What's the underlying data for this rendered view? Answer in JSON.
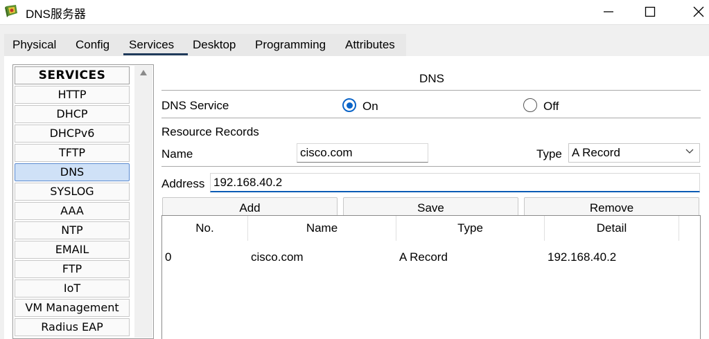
{
  "window": {
    "title": "DNS服务器"
  },
  "tabs": [
    {
      "label": "Physical"
    },
    {
      "label": "Config"
    },
    {
      "label": "Services",
      "active": true
    },
    {
      "label": "Desktop"
    },
    {
      "label": "Programming"
    },
    {
      "label": "Attributes"
    }
  ],
  "sidebar": {
    "header": "SERVICES",
    "items": [
      "HTTP",
      "DHCP",
      "DHCPv6",
      "TFTP",
      "DNS",
      "SYSLOG",
      "AAA",
      "NTP",
      "EMAIL",
      "FTP",
      "IoT",
      "VM Management",
      "Radius EAP"
    ],
    "selected": "DNS"
  },
  "dns": {
    "title": "DNS",
    "service_label": "DNS Service",
    "on_label": "On",
    "off_label": "Off",
    "service_state": "On",
    "resource_records_label": "Resource Records",
    "name_label": "Name",
    "name_value": "cisco.com",
    "type_label": "Type",
    "type_value": "A Record",
    "address_label": "Address",
    "address_value": "192.168.40.2",
    "buttons": {
      "add": "Add",
      "save": "Save",
      "remove": "Remove"
    },
    "table": {
      "columns": [
        "No.",
        "Name",
        "Type",
        "Detail"
      ],
      "rows": [
        {
          "no": "0",
          "name": "cisco.com",
          "type": "A Record",
          "detail": "192.168.40.2"
        }
      ]
    }
  },
  "colors": {
    "accent": "#0a64c8",
    "selected_bg": "#cfe1f7",
    "tab_underline": "#1f3a5a"
  }
}
